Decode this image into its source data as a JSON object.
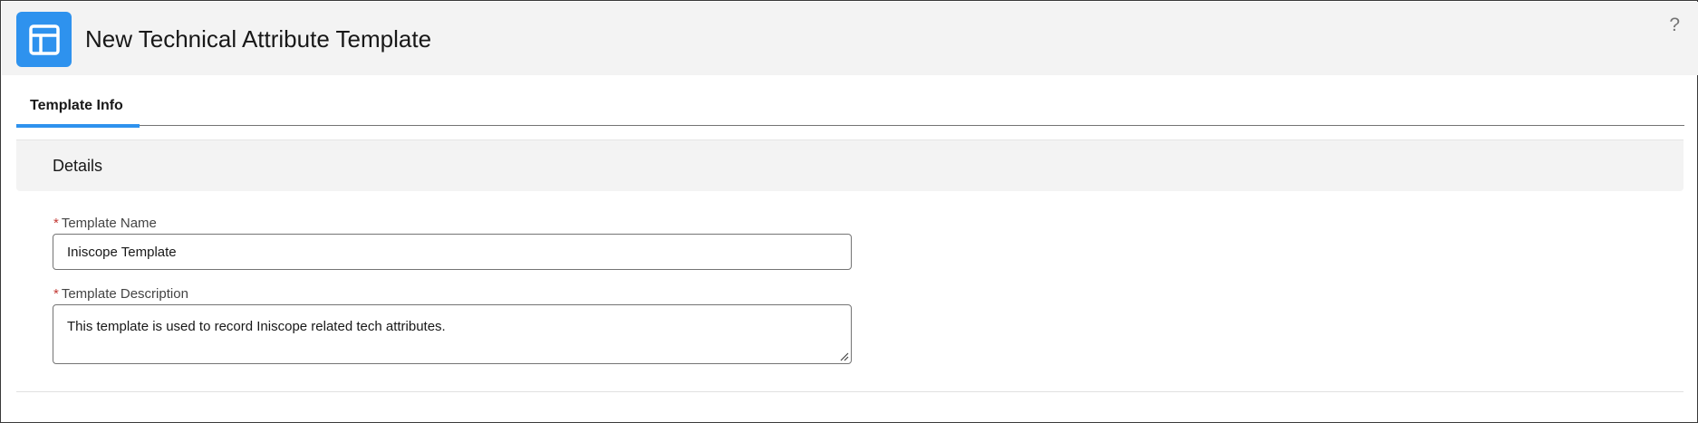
{
  "header": {
    "title": "New Technical Attribute Template",
    "app_icon": "template-icon",
    "help_label": "?",
    "accent_color": "#2e92ee"
  },
  "tabs": [
    {
      "label": "Template Info",
      "active": true
    }
  ],
  "section": {
    "title": "Details"
  },
  "form": {
    "required_marker": "*",
    "template_name": {
      "label": "Template Name",
      "value": "Iniscope Template"
    },
    "template_description": {
      "label": "Template Description",
      "value": "This template is used to record Iniscope related tech attributes."
    }
  }
}
